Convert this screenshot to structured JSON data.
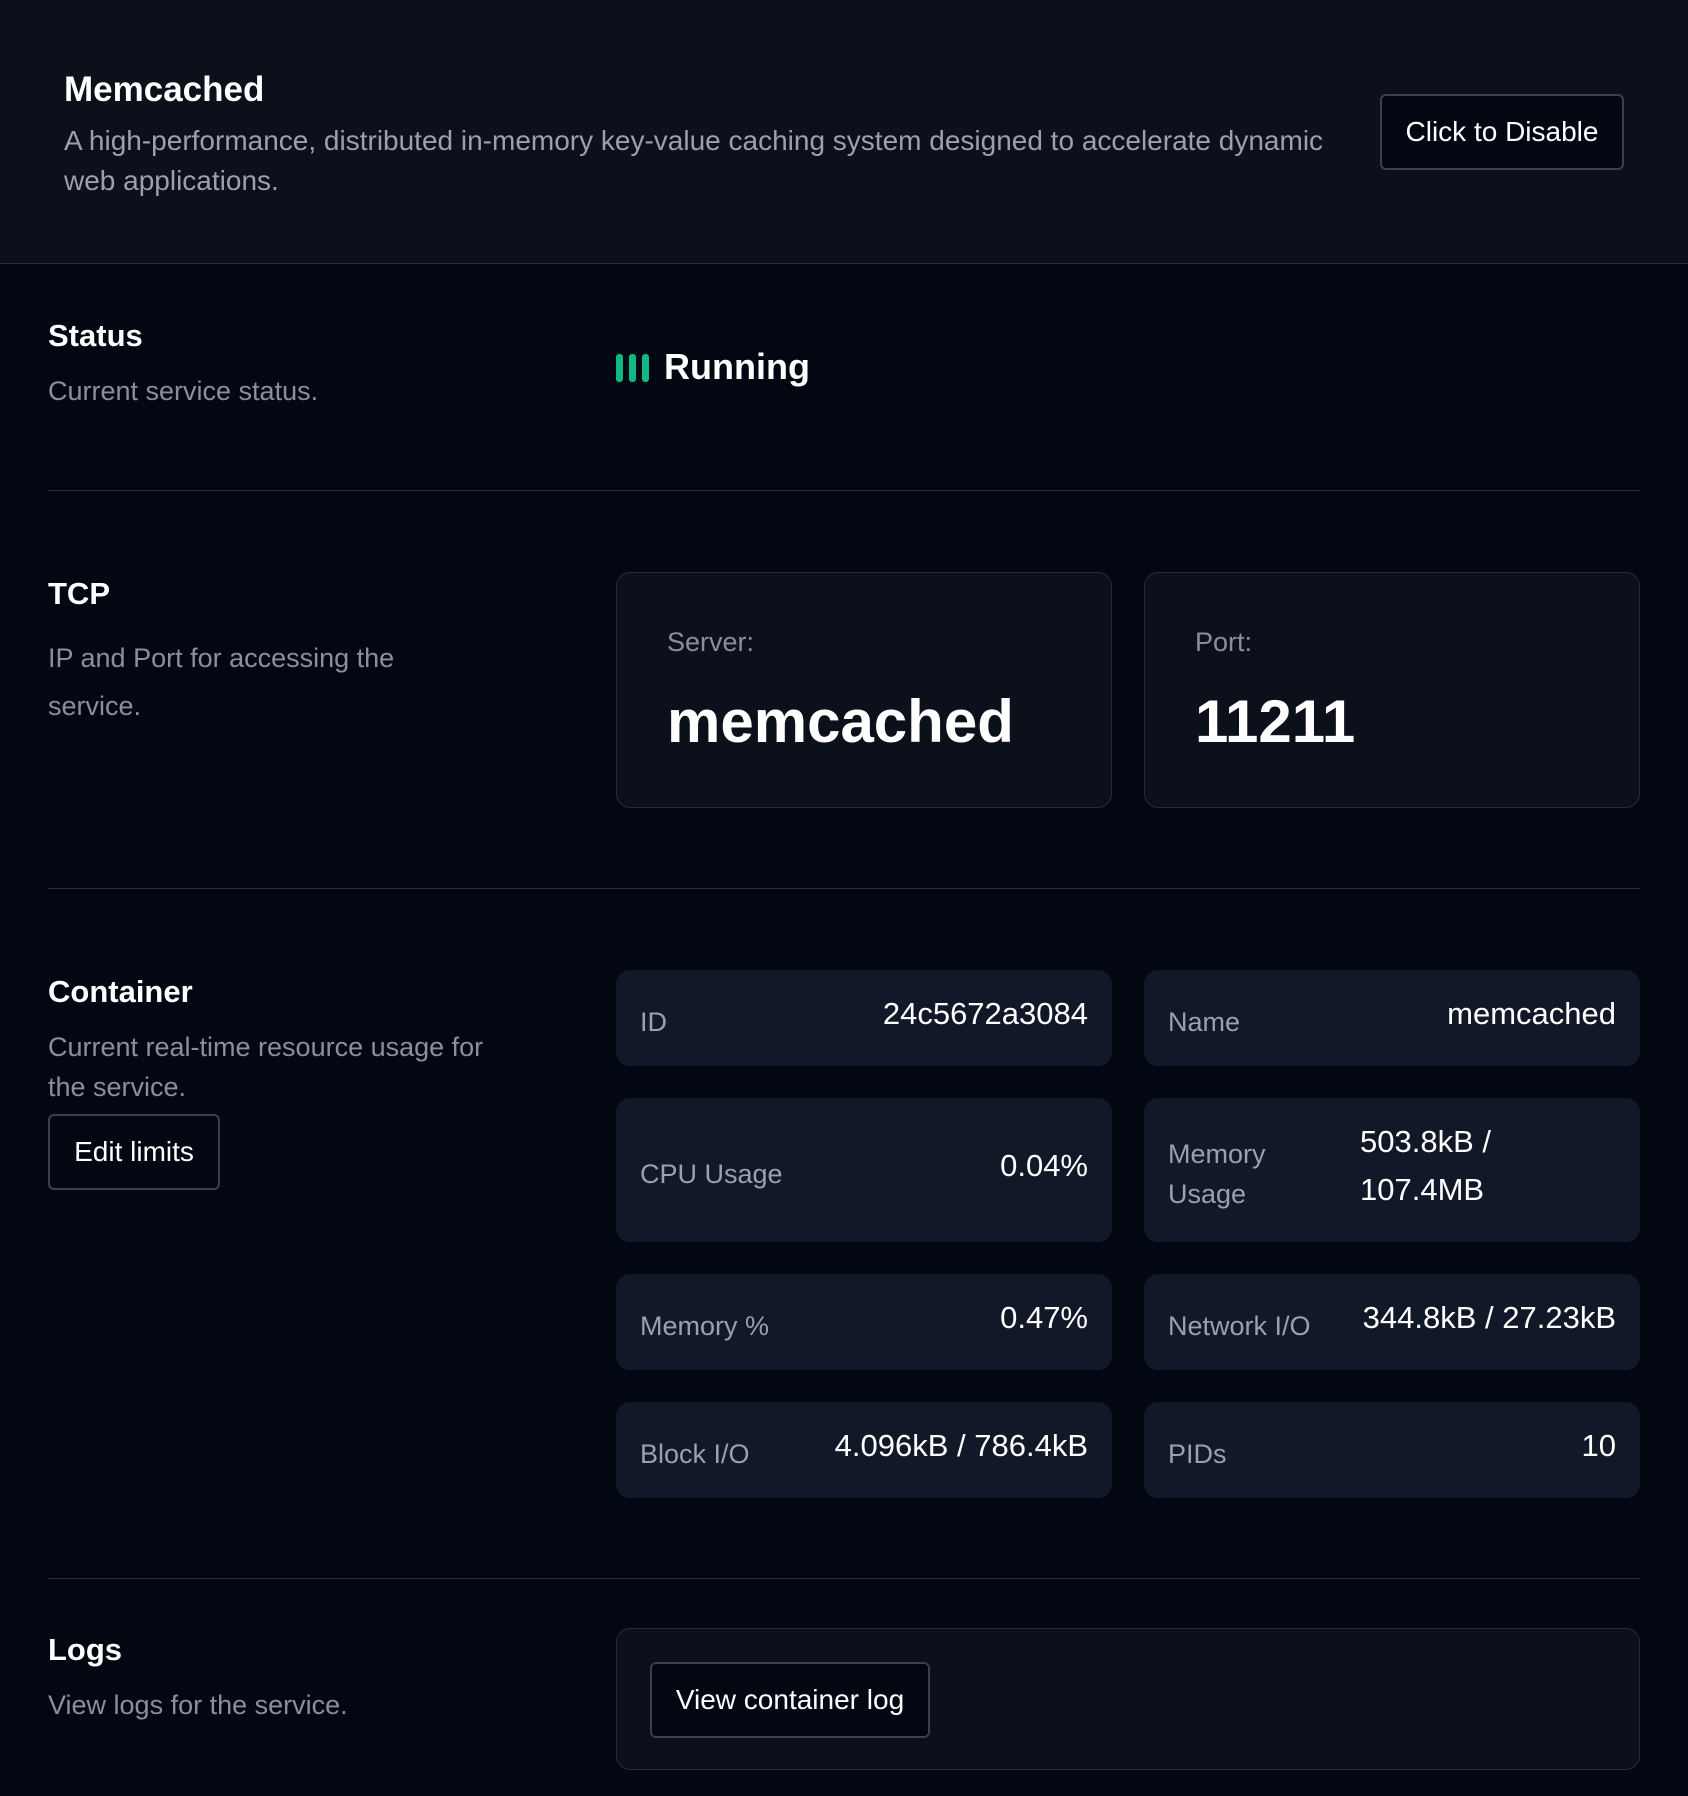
{
  "header": {
    "title": "Memcached",
    "description": "A high-performance, distributed in-memory key-value caching system designed to accelerate dynamic web applications.",
    "disable_button": "Click to Disable"
  },
  "status": {
    "title": "Status",
    "description": "Current service status.",
    "value": "Running",
    "indicator_color": "#10b981"
  },
  "tcp": {
    "title": "TCP",
    "description": "IP and Port for accessing the service.",
    "server_label": "Server:",
    "server_value": "memcached",
    "port_label": "Port:",
    "port_value": "11211"
  },
  "container": {
    "title": "Container",
    "description": "Current real-time resource usage for the service.",
    "edit_button": "Edit limits",
    "stats": [
      {
        "label": "ID",
        "value": "24c5672a3084"
      },
      {
        "label": "Name",
        "value": "memcached"
      },
      {
        "label": "CPU Usage",
        "value": "0.04%"
      },
      {
        "label": "Memory Usage",
        "value": "503.8kB / 107.4MB"
      },
      {
        "label": "Memory %",
        "value": "0.47%"
      },
      {
        "label": "Network I/O",
        "value": "344.8kB / 27.23kB"
      },
      {
        "label": "Block I/O",
        "value": "4.096kB / 786.4kB"
      },
      {
        "label": "PIDs",
        "value": "10"
      }
    ]
  },
  "logs": {
    "title": "Logs",
    "description": "View logs for the service.",
    "view_button": "View container log"
  }
}
